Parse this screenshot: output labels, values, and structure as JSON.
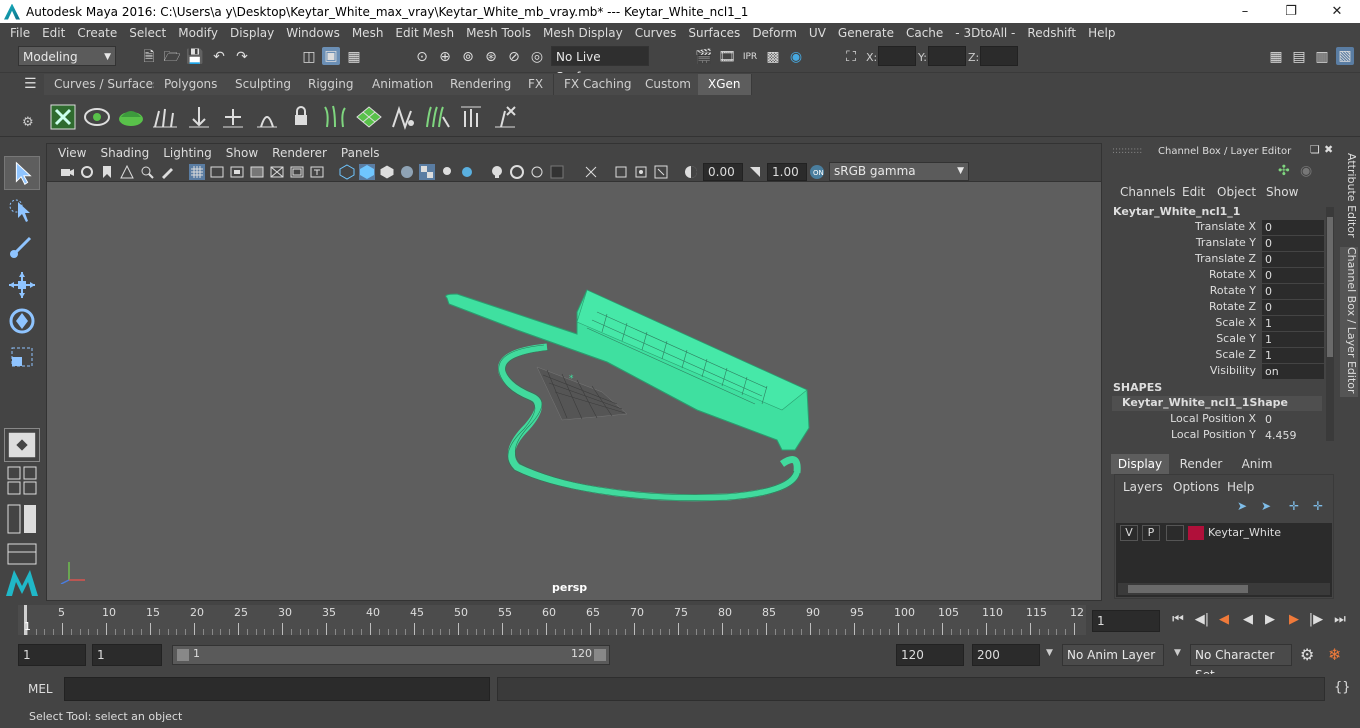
{
  "window": {
    "title": "Autodesk Maya 2016: C:\\Users\\a y\\Desktop\\Keytar_White_max_vray\\Keytar_White_mb_vray.mb*   ---   Keytar_White_ncl1_1",
    "minimize": "–",
    "maximize": "❐",
    "close": "✕"
  },
  "menubar": [
    "File",
    "Edit",
    "Create",
    "Select",
    "Modify",
    "Display",
    "Windows",
    "Mesh",
    "Edit Mesh",
    "Mesh Tools",
    "Mesh Display",
    "Curves",
    "Surfaces",
    "Deform",
    "UV",
    "Generate",
    "Cache",
    "- 3DtoAll -",
    "Redshift",
    "Help"
  ],
  "statusline": {
    "mode": "Modeling",
    "live_surface": "No Live Surface",
    "x_label": "X:",
    "y_label": "Y:",
    "z_label": "Z:"
  },
  "shelf_tabs": [
    "Curves / Surfaces",
    "Polygons",
    "Sculpting",
    "Rigging",
    "Animation",
    "Rendering",
    "FX",
    "FX Caching",
    "Custom",
    "XGen"
  ],
  "shelf_active": "XGen",
  "viewport": {
    "menus": [
      "View",
      "Shading",
      "Lighting",
      "Show",
      "Renderer",
      "Panels"
    ],
    "exposure": "0.00",
    "gamma": "1.00",
    "color_space": "sRGB gamma",
    "camera": "persp",
    "wire_color": "#3fe0a0"
  },
  "channel_box": {
    "title": "Channel Box / Layer Editor",
    "menus": [
      "Channels",
      "Edit",
      "Object",
      "Show"
    ],
    "object": "Keytar_White_ncl1_1",
    "attributes": [
      {
        "label": "Translate X",
        "value": "0"
      },
      {
        "label": "Translate Y",
        "value": "0"
      },
      {
        "label": "Translate Z",
        "value": "0"
      },
      {
        "label": "Rotate X",
        "value": "0"
      },
      {
        "label": "Rotate Y",
        "value": "0"
      },
      {
        "label": "Rotate Z",
        "value": "0"
      },
      {
        "label": "Scale X",
        "value": "1"
      },
      {
        "label": "Scale Y",
        "value": "1"
      },
      {
        "label": "Scale Z",
        "value": "1"
      },
      {
        "label": "Visibility",
        "value": "on"
      }
    ],
    "shapes_header": "SHAPES",
    "shape_name": "Keytar_White_ncl1_1Shape",
    "shape_attributes": [
      {
        "label": "Local Position X",
        "value": "0"
      },
      {
        "label": "Local Position Y",
        "value": "4.459"
      }
    ]
  },
  "side_tabs": [
    "Attribute Editor",
    "Channel Box / Layer Editor"
  ],
  "layer_editor": {
    "tabs": [
      "Display",
      "Render",
      "Anim"
    ],
    "menus": [
      "Layers",
      "Options",
      "Help"
    ],
    "layer": {
      "v": "V",
      "p": "P",
      "name": "Keytar_White",
      "color": "#b0103a"
    }
  },
  "timeline": {
    "ticks": [
      "5",
      "10",
      "15",
      "20",
      "25",
      "30",
      "35",
      "40",
      "45",
      "50",
      "55",
      "60",
      "65",
      "70",
      "75",
      "80",
      "85",
      "90",
      "95",
      "100",
      "105",
      "110",
      "115",
      "12"
    ],
    "first_frame_label": "1",
    "current_frame": "1"
  },
  "range": {
    "start": "1",
    "playback_start": "1",
    "slider_start": "1",
    "slider_end": "120",
    "playback_end": "120",
    "end": "200",
    "anim_layer": "No Anim Layer",
    "character_set": "No Character Set"
  },
  "cmdline": {
    "label": "MEL"
  },
  "helpline": "Select Tool: select an object"
}
